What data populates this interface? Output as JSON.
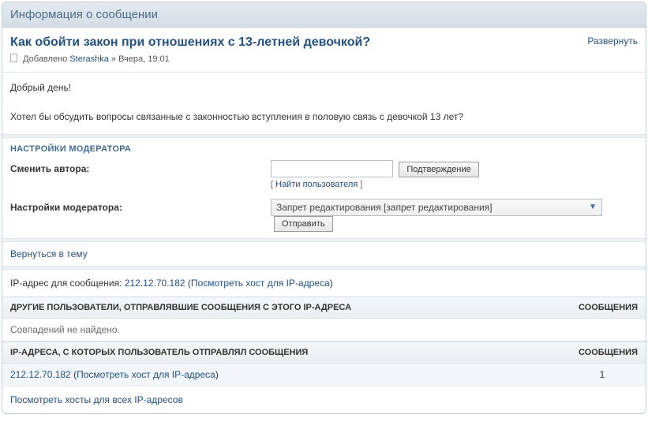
{
  "header": {
    "title": "Информация о сообщении"
  },
  "post": {
    "title": "Как обойти закон при отношениях с 13-летней девочкой?",
    "expand": "Развернуть",
    "added_prefix": "Добавлено",
    "author": "Sterashka",
    "date": "Вчера, 19:01",
    "body_line1": "Добрый день!",
    "body_line2": "Хотел бы обсудить вопросы связанные с законностью вступления в половую связь с девочкой 13 лет?"
  },
  "mod": {
    "heading": "НАСТРОЙКИ МОДЕРАТОРА",
    "change_author_label": "Сменить автора:",
    "change_author_placeholder": "",
    "confirm": "Подтверждение",
    "find_user": "Найти пользователя",
    "settings_label": "Настройки модератора:",
    "action_selected": "Запрет редактирования [запрет редактирования]",
    "submit": "Отправить",
    "back": "Вернуться в тему"
  },
  "ip": {
    "prefix": "IP-адрес для сообщения: ",
    "address": "212.12.70.182",
    "host_lookup": "Посмотреть хост для IP-адреса"
  },
  "table1": {
    "head_main": "ДРУГИЕ ПОЛЬЗОВАТЕЛИ, ОТПРАВЛЯВШИЕ СООБЩЕНИЯ С ЭТОГО IP-АДРЕСА",
    "head_msgs": "СООБЩЕНИЯ",
    "no_match": "Совпадений не найдено."
  },
  "table2": {
    "head_main": "IP-АДРЕСА, С КОТОРЫХ ПОЛЬЗОВАТЕЛЬ ОТПРАВЛЯЛ СООБЩЕНИЯ",
    "head_msgs": "СООБЩЕНИЯ",
    "row_ip": "212.12.70.182",
    "row_host": "Посмотреть хост для IP-адреса",
    "row_count": "1"
  },
  "footer": {
    "all_hosts": "Посмотреть хосты для всех IP-адресов"
  }
}
